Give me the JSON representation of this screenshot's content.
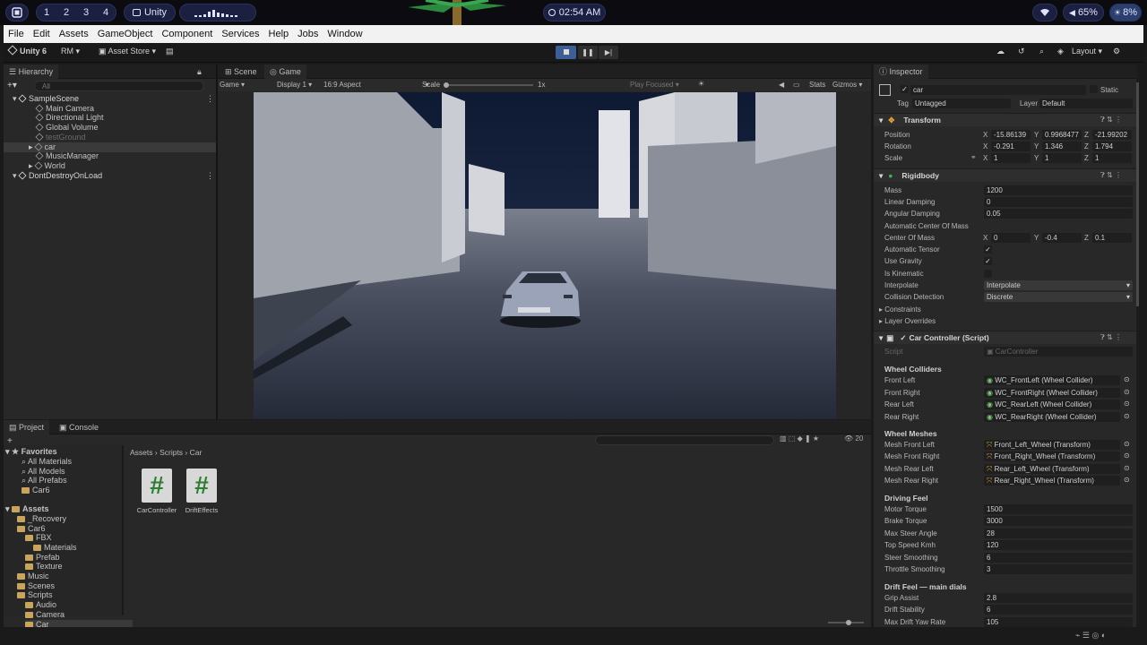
{
  "desktop": {
    "workspaces": [
      "1",
      "2",
      "3",
      "4"
    ],
    "active_app": "Unity",
    "clock": "02:54 AM",
    "volume": "65%",
    "brightness": "8%"
  },
  "menu": [
    "File",
    "Edit",
    "Assets",
    "GameObject",
    "Component",
    "Services",
    "Help",
    "Jobs",
    "Window"
  ],
  "toolbar": {
    "product": "Unity 6",
    "account": "RM",
    "asset_store": "Asset Store",
    "layout": "Layout"
  },
  "hierarchy": {
    "tab": "Hierarchy",
    "search_placeholder": "All",
    "items": [
      {
        "label": "SampleScene",
        "depth": 0,
        "type": "scene"
      },
      {
        "label": "Main Camera",
        "depth": 1,
        "type": "obj"
      },
      {
        "label": "Directional Light",
        "depth": 1,
        "type": "obj"
      },
      {
        "label": "Global Volume",
        "depth": 1,
        "type": "obj"
      },
      {
        "label": "testGround",
        "depth": 1,
        "type": "obj",
        "dim": true
      },
      {
        "label": "car",
        "depth": 1,
        "type": "obj",
        "selected": true
      },
      {
        "label": "MusicManager",
        "depth": 1,
        "type": "obj"
      },
      {
        "label": "World",
        "depth": 1,
        "type": "obj"
      },
      {
        "label": "DontDestroyOnLoad",
        "depth": 0,
        "type": "scene"
      }
    ]
  },
  "view": {
    "tabs": [
      "Scene",
      "Game"
    ],
    "game_label": "Game",
    "display": "Display 1",
    "aspect": "16:9 Aspect",
    "scale_label": "Scale",
    "scale_value": "1x",
    "play_focused": "Play Focused",
    "stats": "Stats",
    "gizmos": "Gizmos"
  },
  "inspector": {
    "tab": "Inspector",
    "object_name": "car",
    "static_label": "Static",
    "tag_label": "Tag",
    "tag": "Untagged",
    "layer_label": "Layer",
    "layer": "Default",
    "transform": {
      "title": "Transform",
      "position_label": "Position",
      "position": [
        "-15.86139",
        "0.9968477",
        "-21.99202"
      ],
      "rotation_label": "Rotation",
      "rotation": [
        "-0.291",
        "1.346",
        "1.794"
      ],
      "scale_label": "Scale",
      "scale": [
        "1",
        "1",
        "1"
      ]
    },
    "rigidbody": {
      "title": "Rigidbody",
      "mass_label": "Mass",
      "mass": "1200",
      "linear_damping_label": "Linear Damping",
      "linear_damping": "0",
      "angular_damping_label": "Angular Damping",
      "angular_damping": "0.05",
      "auto_com_label": "Automatic Center Of Mass",
      "com_label": "Center Of Mass",
      "com": [
        "0",
        "-0.4",
        "0.1"
      ],
      "auto_tensor_label": "Automatic Tensor",
      "use_gravity_label": "Use Gravity",
      "is_kinematic_label": "Is Kinematic",
      "interpolate_label": "Interpolate",
      "interpolate": "Interpolate",
      "collision_label": "Collision Detection",
      "collision": "Discrete",
      "constraints": "Constraints",
      "layer_overrides": "Layer Overrides"
    },
    "car_controller": {
      "title": "Car Controller (Script)",
      "script_label": "Script",
      "script": "CarController",
      "wheel_colliders": "Wheel Colliders",
      "colliders": [
        {
          "label": "Front Left",
          "value": "WC_FrontLeft (Wheel Collider)"
        },
        {
          "label": "Front Right",
          "value": "WC_FrontRight (Wheel Collider)"
        },
        {
          "label": "Rear Left",
          "value": "WC_RearLeft (Wheel Collider)"
        },
        {
          "label": "Rear Right",
          "value": "WC_RearRight (Wheel Collider)"
        }
      ],
      "wheel_meshes": "Wheel Meshes",
      "meshes": [
        {
          "label": "Mesh Front Left",
          "value": "Front_Left_Wheel (Transform)"
        },
        {
          "label": "Mesh Front Right",
          "value": "Front_Right_Wheel (Transform)"
        },
        {
          "label": "Mesh Rear Left",
          "value": "Rear_Left_Wheel (Transform)"
        },
        {
          "label": "Mesh Rear Right",
          "value": "Rear_Right_Wheel (Transform)"
        }
      ],
      "driving_feel": "Driving Feel",
      "driving": [
        {
          "label": "Motor Torque",
          "value": "1500"
        },
        {
          "label": "Brake Torque",
          "value": "3000"
        },
        {
          "label": "Max Steer Angle",
          "value": "28"
        },
        {
          "label": "Top Speed Kmh",
          "value": "120"
        },
        {
          "label": "Steer Smoothing",
          "value": "6"
        },
        {
          "label": "Throttle Smoothing",
          "value": "3"
        }
      ],
      "drift_feel": "Drift Feel — main dials",
      "drift": [
        {
          "label": "Grip Assist",
          "value": "2.8"
        },
        {
          "label": "Drift Stability",
          "value": "6"
        },
        {
          "label": "Max Drift Yaw Rate",
          "value": "105"
        }
      ]
    }
  },
  "project": {
    "tabs": [
      "Project",
      "Console"
    ],
    "breadcrumb": [
      "Assets",
      "Scripts",
      "Car"
    ],
    "count": "20",
    "favorites_label": "Favorites",
    "favorites": [
      "All Materials",
      "All Models",
      "All Prefabs",
      "Car6"
    ],
    "assets_label": "Assets",
    "tree": [
      {
        "label": "_Recovery",
        "depth": 1
      },
      {
        "label": "Car6",
        "depth": 1
      },
      {
        "label": "FBX",
        "depth": 2
      },
      {
        "label": "Materials",
        "depth": 3
      },
      {
        "label": "Prefab",
        "depth": 2
      },
      {
        "label": "Texture",
        "depth": 2
      },
      {
        "label": "Music",
        "depth": 1
      },
      {
        "label": "Scenes",
        "depth": 1
      },
      {
        "label": "Scripts",
        "depth": 1
      },
      {
        "label": "Audio",
        "depth": 2
      },
      {
        "label": "Camera",
        "depth": 2
      },
      {
        "label": "Car",
        "depth": 2
      }
    ],
    "files": [
      "CarController",
      "DriftEffects"
    ]
  },
  "colors": {
    "accent": "#3d5f96",
    "selection": "#2c4a77",
    "script_icon": "#2e7d32"
  }
}
